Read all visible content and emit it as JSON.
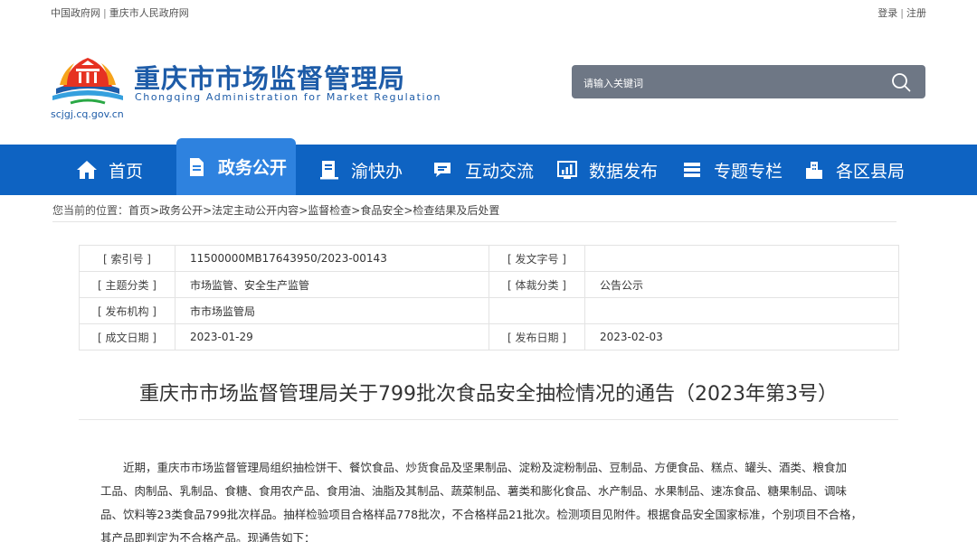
{
  "topbar": {
    "link_gov": "中国政府网",
    "link_cq": "重庆市人民政府网",
    "login": "登录",
    "register": "注册"
  },
  "header": {
    "title_cn": "重庆市市场监督管理局",
    "title_en": "Chongqing  Administration for Market Regulation",
    "domain": "scjgj.cq.gov.cn"
  },
  "search": {
    "placeholder": "请输入关键词",
    "icon": "search-icon"
  },
  "nav": {
    "items": [
      {
        "label": "首页",
        "icon": "home-icon"
      },
      {
        "label": "政务公开",
        "icon": "document-icon",
        "active": true
      },
      {
        "label": "渝快办",
        "icon": "book-icon"
      },
      {
        "label": "互动交流",
        "icon": "chat-icon"
      },
      {
        "label": "数据发布",
        "icon": "chart-icon"
      },
      {
        "label": "专题专栏",
        "icon": "stack-icon"
      },
      {
        "label": "各区县局",
        "icon": "buildings-icon"
      }
    ]
  },
  "breadcrumb": {
    "label": "您当前的位置：",
    "items": [
      "首页",
      "政务公开",
      "法定主动公开内容",
      "监督检查",
      "食品安全",
      "检查结果及后处置"
    ],
    "separator": ">"
  },
  "info": {
    "rows": [
      {
        "k1": "[ 索引号 ]",
        "v1": "11500000MB17643950/2023-00143",
        "k2": "[ 发文字号 ]",
        "v2": ""
      },
      {
        "k1": "[ 主题分类 ]",
        "v1": "市场监管、安全生产监管",
        "k2": "[ 体裁分类 ]",
        "v2": "公告公示"
      },
      {
        "k1": "[ 发布机构 ]",
        "v1": "市市场监管局",
        "k2": "",
        "v2": ""
      },
      {
        "k1": "[ 成文日期 ]",
        "v1": "2023-01-29",
        "k2": "[ 发布日期 ]",
        "v2": "2023-02-03"
      }
    ]
  },
  "article": {
    "title": "重庆市市场监督管理局关于799批次食品安全抽检情况的通告（2023年第3号）",
    "lines": [
      "　　近期，重庆市市场监督管理局组织抽检饼干、餐饮食品、炒货食品及坚果制品、淀粉及淀粉制品、豆制品、方便食品、糕点、罐头、酒类、粮食加",
      "工品、肉制品、乳制品、食糖、食用农产品、食用油、油脂及其制品、蔬菜制品、薯类和膨化食品、水产制品、水果制品、速冻食品、糖果制品、调味",
      "品、饮料等23类食品799批次样品。抽样检验项目合格样品778批次，不合格样品21批次。检测项目见附件。根据食品安全国家标准，个别项目不合格，",
      "其产品即判定为不合格产品。现通告如下："
    ]
  },
  "colors": {
    "brand_blue": "#1e5ca8",
    "nav_blue": "#0e63c2",
    "nav_active": "#2e82df",
    "search_bg": "#6e7785"
  }
}
